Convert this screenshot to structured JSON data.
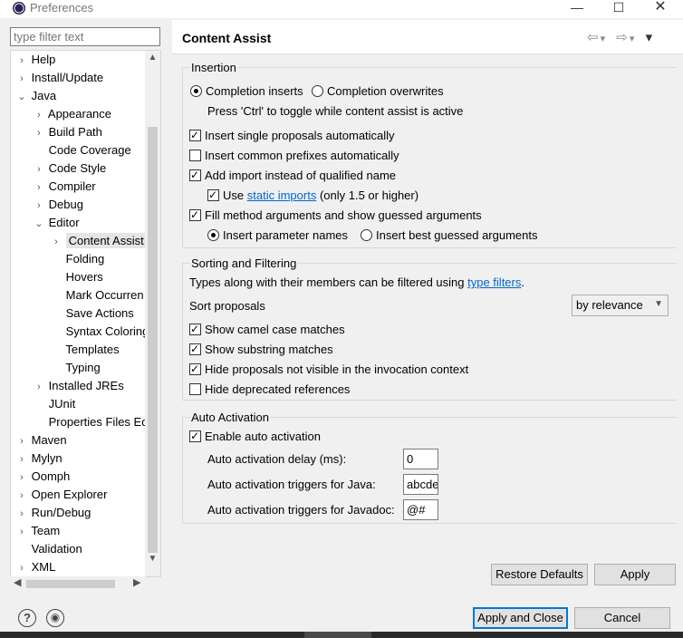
{
  "window": {
    "title": "Preferences",
    "min": "—",
    "max": "☐",
    "close": "✕"
  },
  "filter": {
    "placeholder": "type filter text"
  },
  "tree": [
    {
      "label": "Help",
      "chev": "›",
      "indent": 0
    },
    {
      "label": "Install/Update",
      "chev": "›",
      "indent": 0
    },
    {
      "label": "Java",
      "chev": "⌄",
      "indent": 0
    },
    {
      "label": "Appearance",
      "chev": "›",
      "indent": 1
    },
    {
      "label": "Build Path",
      "chev": "›",
      "indent": 1
    },
    {
      "label": "Code Coverage",
      "chev": "",
      "indent": 1
    },
    {
      "label": "Code Style",
      "chev": "›",
      "indent": 1
    },
    {
      "label": "Compiler",
      "chev": "›",
      "indent": 1
    },
    {
      "label": "Debug",
      "chev": "›",
      "indent": 1
    },
    {
      "label": "Editor",
      "chev": "⌄",
      "indent": 1
    },
    {
      "label": "Content Assist",
      "chev": "›",
      "indent": 2,
      "selected": true
    },
    {
      "label": "Folding",
      "chev": "",
      "indent": 2
    },
    {
      "label": "Hovers",
      "chev": "",
      "indent": 2
    },
    {
      "label": "Mark Occurren",
      "chev": "",
      "indent": 2
    },
    {
      "label": "Save Actions",
      "chev": "",
      "indent": 2
    },
    {
      "label": "Syntax Coloring",
      "chev": "",
      "indent": 2
    },
    {
      "label": "Templates",
      "chev": "",
      "indent": 2
    },
    {
      "label": "Typing",
      "chev": "",
      "indent": 2
    },
    {
      "label": "Installed JREs",
      "chev": "›",
      "indent": 1
    },
    {
      "label": "JUnit",
      "chev": "",
      "indent": 1
    },
    {
      "label": "Properties Files Ed",
      "chev": "",
      "indent": 1
    },
    {
      "label": "Maven",
      "chev": "›",
      "indent": 0
    },
    {
      "label": "Mylyn",
      "chev": "›",
      "indent": 0
    },
    {
      "label": "Oomph",
      "chev": "›",
      "indent": 0
    },
    {
      "label": "Open Explorer",
      "chev": "›",
      "indent": 0
    },
    {
      "label": "Run/Debug",
      "chev": "›",
      "indent": 0
    },
    {
      "label": "Team",
      "chev": "›",
      "indent": 0
    },
    {
      "label": "Validation",
      "chev": "",
      "indent": 0
    },
    {
      "label": "XML",
      "chev": "›",
      "indent": 0
    }
  ],
  "page": {
    "title": "Content Assist",
    "nav": {
      "back": "⇦",
      "back_menu": "▾",
      "forward": "⇨",
      "forward_menu": "▾",
      "view_menu": "▾"
    }
  },
  "insertion": {
    "legend": "Insertion",
    "completion_inserts": "Completion inserts",
    "completion_overwrites": "Completion overwrites",
    "toggle_hint": "Press 'Ctrl' to toggle while content assist is active",
    "insert_single": "Insert single proposals automatically",
    "insert_common": "Insert common prefixes automatically",
    "add_import": "Add import instead of qualified name",
    "use_prefix": "Use",
    "static_imports": "static imports",
    "use_suffix": "(only 1.5 or higher)",
    "fill_method": "Fill method arguments and show guessed arguments",
    "insert_param_names": "Insert parameter names",
    "insert_best_guessed": "Insert best guessed arguments"
  },
  "sorting": {
    "legend": "Sorting and Filtering",
    "types_prefix": "Types along with their members can be filtered using",
    "type_filters": "type filters",
    "types_suffix": ".",
    "sort_proposals": "Sort proposals",
    "sort_value": "by relevance",
    "camel_case": "Show camel case matches",
    "substring": "Show substring matches",
    "hide_invisible": "Hide proposals not visible in the invocation context",
    "hide_deprecated": "Hide deprecated references"
  },
  "auto": {
    "legend": "Auto Activation",
    "enable": "Enable auto activation",
    "delay_label": "Auto activation delay (ms):",
    "delay_value": "0",
    "java_label": "Auto activation triggers for Java:",
    "java_value": "abcdefghijklmnopqrstuvwxyz",
    "javadoc_label": "Auto activation triggers for Javadoc:",
    "javadoc_value": "@#"
  },
  "buttons": {
    "restore_defaults": "Restore Defaults",
    "apply": "Apply",
    "apply_close": "Apply and Close",
    "cancel": "Cancel"
  },
  "footer": {
    "help": "?",
    "prefs": "◉"
  }
}
